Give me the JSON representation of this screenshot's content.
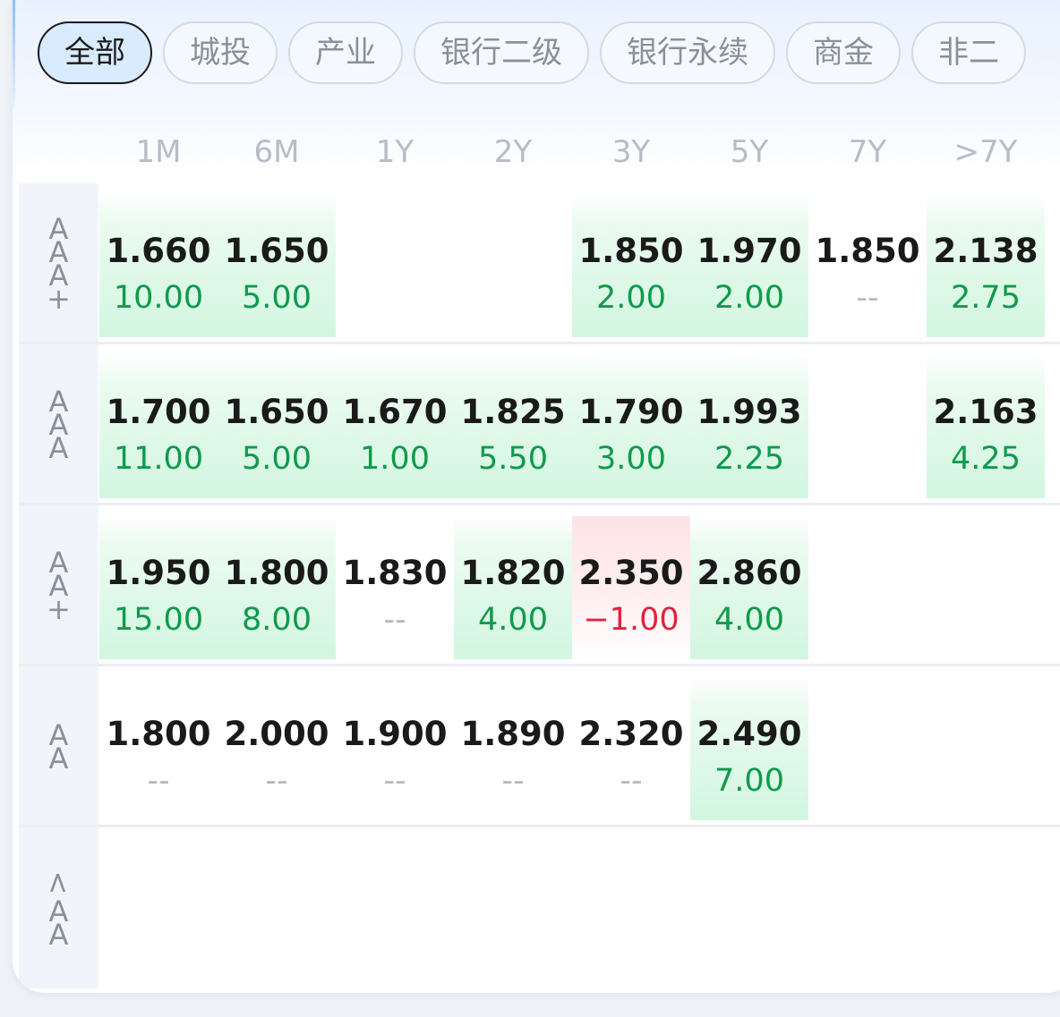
{
  "tabs": [
    "全部",
    "城投",
    "产业",
    "银行二级",
    "银行永续",
    "商金",
    "非二"
  ],
  "active_tab": 0,
  "columns": [
    "1M",
    "6M",
    "1Y",
    "2Y",
    "3Y",
    "5Y",
    "7Y",
    ">7Y"
  ],
  "grades": [
    "AAA+",
    "AAA",
    "AA+",
    "AA",
    "<AA"
  ],
  "rows": [
    [
      {
        "yield": "1.660",
        "change": "10.00",
        "tone": "up"
      },
      {
        "yield": "1.650",
        "change": "5.00",
        "tone": "up"
      },
      null,
      null,
      {
        "yield": "1.850",
        "change": "2.00",
        "tone": "up"
      },
      {
        "yield": "1.970",
        "change": "2.00",
        "tone": "up"
      },
      {
        "yield": "1.850",
        "change": "--",
        "tone": "none"
      },
      {
        "yield": "2.138",
        "change": "2.75",
        "tone": "up"
      }
    ],
    [
      {
        "yield": "1.700",
        "change": "11.00",
        "tone": "up"
      },
      {
        "yield": "1.650",
        "change": "5.00",
        "tone": "up"
      },
      {
        "yield": "1.670",
        "change": "1.00",
        "tone": "up"
      },
      {
        "yield": "1.825",
        "change": "5.50",
        "tone": "up"
      },
      {
        "yield": "1.790",
        "change": "3.00",
        "tone": "up"
      },
      {
        "yield": "1.993",
        "change": "2.25",
        "tone": "up"
      },
      null,
      {
        "yield": "2.163",
        "change": "4.25",
        "tone": "up"
      }
    ],
    [
      {
        "yield": "1.950",
        "change": "15.00",
        "tone": "up"
      },
      {
        "yield": "1.800",
        "change": "8.00",
        "tone": "up"
      },
      {
        "yield": "1.830",
        "change": "--",
        "tone": "none"
      },
      {
        "yield": "1.820",
        "change": "4.00",
        "tone": "up"
      },
      {
        "yield": "2.350",
        "change": "−1.00",
        "tone": "down"
      },
      {
        "yield": "2.860",
        "change": "4.00",
        "tone": "up"
      },
      null,
      null
    ],
    [
      {
        "yield": "1.800",
        "change": "--",
        "tone": "none"
      },
      {
        "yield": "2.000",
        "change": "--",
        "tone": "none"
      },
      {
        "yield": "1.900",
        "change": "--",
        "tone": "none"
      },
      {
        "yield": "1.890",
        "change": "--",
        "tone": "none"
      },
      {
        "yield": "2.320",
        "change": "--",
        "tone": "none"
      },
      {
        "yield": "2.490",
        "change": "7.00",
        "tone": "up"
      },
      null,
      null
    ],
    [
      null,
      null,
      null,
      null,
      null,
      null,
      null,
      null
    ]
  ],
  "colors": {
    "up": "#0f9a4c",
    "down": "#e0243c",
    "none": "#b5b9c1",
    "active_tab_bg": "#d8ebff"
  }
}
